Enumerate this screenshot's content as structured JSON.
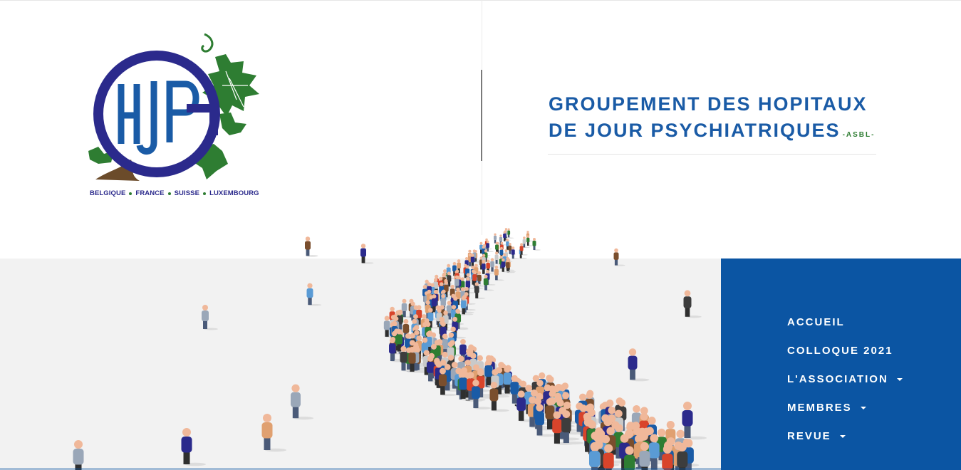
{
  "header": {
    "title_line1": "GROUPEMENT DES HOPITAUX",
    "title_line2": "DE JOUR PSYCHIATRIQUES",
    "suffix": "-ASBL-"
  },
  "logo": {
    "monogram": "GHJP",
    "countries": [
      "BELGIQUE",
      "FRANCE",
      "SUISSE",
      "LUXEMBOURG"
    ],
    "ring_color": "#2b2a8c",
    "letter_color": "#1a5ba6",
    "leaf_color": "#2e7d32"
  },
  "nav": {
    "items": [
      {
        "label": "ACCUEIL",
        "dropdown": false
      },
      {
        "label": "COLLOQUE 2021",
        "dropdown": false
      },
      {
        "label": "L'ASSOCIATION",
        "dropdown": true
      },
      {
        "label": "MEMBRES",
        "dropdown": true
      },
      {
        "label": "REVUE",
        "dropdown": true
      }
    ],
    "background": "#0b55a3"
  },
  "hero": {
    "illustration": "crowd-of-people-walking"
  }
}
